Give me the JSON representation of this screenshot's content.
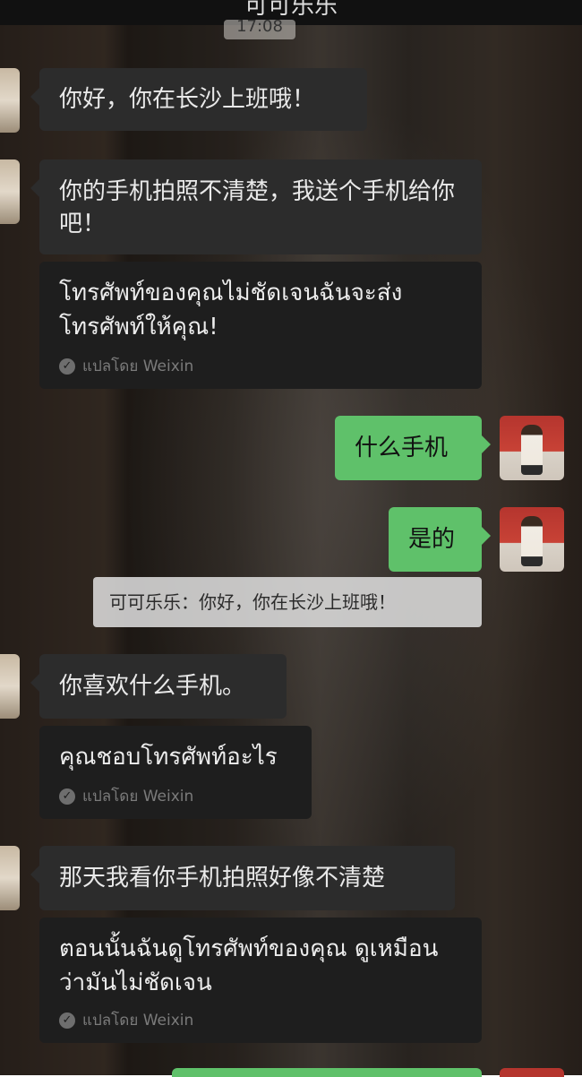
{
  "header": {
    "title": "可可乐乐",
    "timestamp": "17:08"
  },
  "messages": [
    {
      "id": 1,
      "direction": "in",
      "text": "你好，你在长沙上班哦！"
    },
    {
      "id": 2,
      "direction": "in",
      "text": "你的手机拍照不清楚，我送个手机给你吧！",
      "translation": "โทรศัพท์ของคุณไม่ชัดเจนฉันจะส่งโทรศัพท์ให้คุณ!",
      "translated_by": "แปลโดย Weixin"
    },
    {
      "id": 3,
      "direction": "out",
      "text": "什么手机"
    },
    {
      "id": 4,
      "direction": "out",
      "text": "是的"
    },
    {
      "id": 5,
      "direction": "quote",
      "text": "可可乐乐：你好，你在长沙上班哦！"
    },
    {
      "id": 6,
      "direction": "in",
      "text": "你喜欢什么手机。",
      "translation": "คุณชอบโทรศัพท์อะไร",
      "translated_by": "แปลโดย Weixin"
    },
    {
      "id": 7,
      "direction": "in",
      "text": "那天我看你手机拍照好像不清楚",
      "translation": "ตอนนั้นฉันดูโทรศัพท์ของคุณ ดูเหมือนว่ามันไม่ชัดเจน",
      "translated_by": "แปลโดย Weixin"
    }
  ],
  "icons": {
    "translated_check": "check-circle-icon"
  },
  "colors": {
    "incoming_bubble": "#2c2c2c",
    "translation_bubble": "#1e1e1e",
    "outgoing_bubble": "#5fc16a"
  }
}
